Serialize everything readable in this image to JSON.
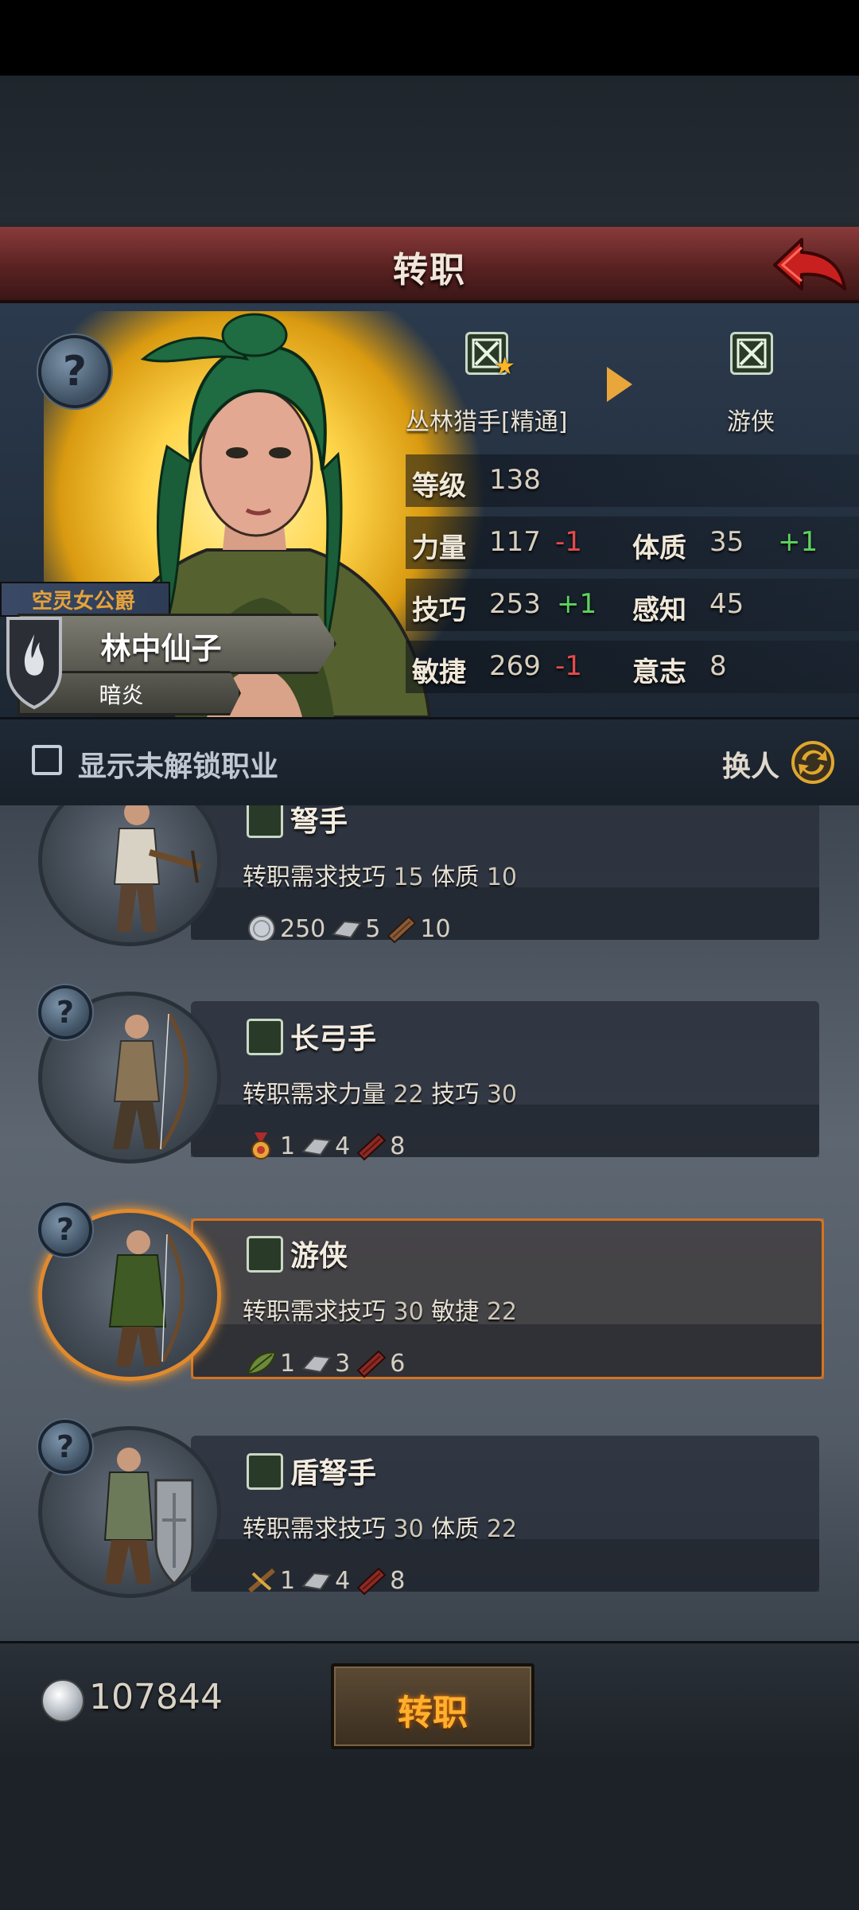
{
  "header": {
    "title": "转职"
  },
  "character": {
    "title_tag": "空灵女公爵",
    "name": "林中仙子",
    "affinity": "暗炎",
    "current_class": "丛林猎手[精通]",
    "target_class": "游侠",
    "level_label": "等级",
    "level": "138",
    "stats": {
      "str_label": "力量",
      "str": "117",
      "str_delta": "-1",
      "con_label": "体质",
      "con": "35",
      "con_delta": "+1",
      "skl_label": "技巧",
      "skl": "253",
      "skl_delta": "+1",
      "per_label": "感知",
      "per": "45",
      "agi_label": "敏捷",
      "agi": "269",
      "agi_delta": "-1",
      "wil_label": "意志",
      "wil": "8"
    }
  },
  "toolbar": {
    "show_locked_label": "显示未解锁职业",
    "swap_label": "换人"
  },
  "jobs": [
    {
      "name": "弩手",
      "req_prefix": "转职需求",
      "req": [
        {
          "stat": "技巧",
          "value": "15"
        },
        {
          "stat": "体质",
          "value": "10"
        }
      ],
      "costs": [
        {
          "icon": "silver-coin-icon",
          "qty": "250"
        },
        {
          "icon": "iron-ingot-icon",
          "qty": "5"
        },
        {
          "icon": "wood-plank-icon",
          "qty": "10"
        }
      ]
    },
    {
      "name": "长弓手",
      "req_prefix": "转职需求",
      "req": [
        {
          "stat": "力量",
          "value": "22"
        },
        {
          "stat": "技巧",
          "value": "30"
        }
      ],
      "costs": [
        {
          "icon": "medal-icon",
          "qty": "1"
        },
        {
          "icon": "iron-ingot-icon",
          "qty": "4"
        },
        {
          "icon": "red-wood-icon",
          "qty": "8"
        }
      ]
    },
    {
      "name": "游侠",
      "req_prefix": "转职需求",
      "req": [
        {
          "stat": "技巧",
          "value": "30"
        },
        {
          "stat": "敏捷",
          "value": "22"
        }
      ],
      "costs": [
        {
          "icon": "leaf-icon",
          "qty": "1"
        },
        {
          "icon": "iron-ingot-icon",
          "qty": "3"
        },
        {
          "icon": "red-wood-icon",
          "qty": "6"
        }
      ],
      "selected": true
    },
    {
      "name": "盾弩手",
      "req_prefix": "转职需求",
      "req": [
        {
          "stat": "技巧",
          "value": "30"
        },
        {
          "stat": "体质",
          "value": "22"
        }
      ],
      "costs": [
        {
          "icon": "crossbow-part-icon",
          "qty": "1"
        },
        {
          "icon": "iron-ingot-icon",
          "qty": "4"
        },
        {
          "icon": "red-wood-icon",
          "qty": "8"
        }
      ]
    }
  ],
  "footer": {
    "money": "107844",
    "change_button": "转职"
  },
  "colors": {
    "title_bar": "#6e2c2c",
    "selected_glow": "#ff9d30",
    "negative": "#e44b4b",
    "positive": "#5ed35e",
    "button_text": "#ffb02e"
  }
}
